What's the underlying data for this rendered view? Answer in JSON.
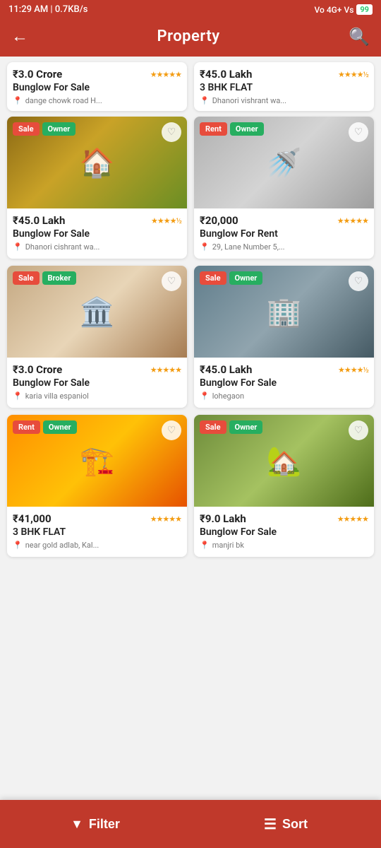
{
  "statusBar": {
    "time": "11:29 AM | 0.7KB/s",
    "network": "Vo 4G+ Vs",
    "battery": "99"
  },
  "header": {
    "title": "Property",
    "backLabel": "←",
    "searchLabel": "🔍"
  },
  "partialCards": [
    {
      "price": "₹3.0 Crore",
      "stars": "★★★★★",
      "title": "Bunglow For Sale",
      "location": "dange chowk road H..."
    },
    {
      "price": "₹45.0 Lakh",
      "stars": "★★★★½",
      "title": "3 BHK FLAT",
      "location": "Dhanori vishrant wa..."
    }
  ],
  "cards": [
    {
      "badge1": "Sale",
      "badge1Type": "sale",
      "badge2": "Owner",
      "badge2Type": "owner",
      "imageClass": "img-bungalow1",
      "imageEmoji": "🏠",
      "price": "₹45.0 Lakh",
      "stars": "★★★★½",
      "title": "Bunglow For Sale",
      "location": "Dhanori cishrant wa..."
    },
    {
      "badge1": "Rent",
      "badge1Type": "rent",
      "badge2": "Owner",
      "badge2Type": "owner",
      "imageClass": "img-bathroom",
      "imageEmoji": "🚿",
      "price": "₹20,000",
      "stars": "★★★★★",
      "title": "Bunglow For Rent",
      "location": "29, Lane Number 5,..."
    },
    {
      "badge1": "Sale",
      "badge1Type": "sale",
      "badge2": "Broker",
      "badge2Type": "broker",
      "imageClass": "img-mansion",
      "imageEmoji": "🏛️",
      "price": "₹3.0 Crore",
      "stars": "★★★★★",
      "title": "Bunglow For Sale",
      "location": "karia villa espaniol"
    },
    {
      "badge1": "Sale",
      "badge1Type": "sale",
      "badge2": "Owner",
      "badge2Type": "owner",
      "imageClass": "img-modern",
      "imageEmoji": "🏢",
      "price": "₹45.0 Lakh",
      "stars": "★★★★½",
      "title": "Bunglow For Sale",
      "location": "lohegaon"
    },
    {
      "badge1": "Rent",
      "badge1Type": "rent",
      "badge2": "Owner",
      "badge2Type": "owner",
      "imageClass": "img-apartment",
      "imageEmoji": "🏗️",
      "price": "₹41,000",
      "stars": "★★★★★",
      "title": "3 BHK FLAT",
      "location": "near gold adlab, Kal..."
    },
    {
      "badge1": "Sale",
      "badge1Type": "sale",
      "badge2": "Owner",
      "badge2Type": "owner",
      "imageClass": "img-house5",
      "imageEmoji": "🏡",
      "price": "₹9.0 Lakh",
      "stars": "★★★★★",
      "title": "Bunglow For Sale",
      "location": "manjri bk"
    }
  ],
  "bottomBar": {
    "filterLabel": "Filter",
    "filterIcon": "▼",
    "sortLabel": "Sort",
    "sortIcon": "≡"
  }
}
